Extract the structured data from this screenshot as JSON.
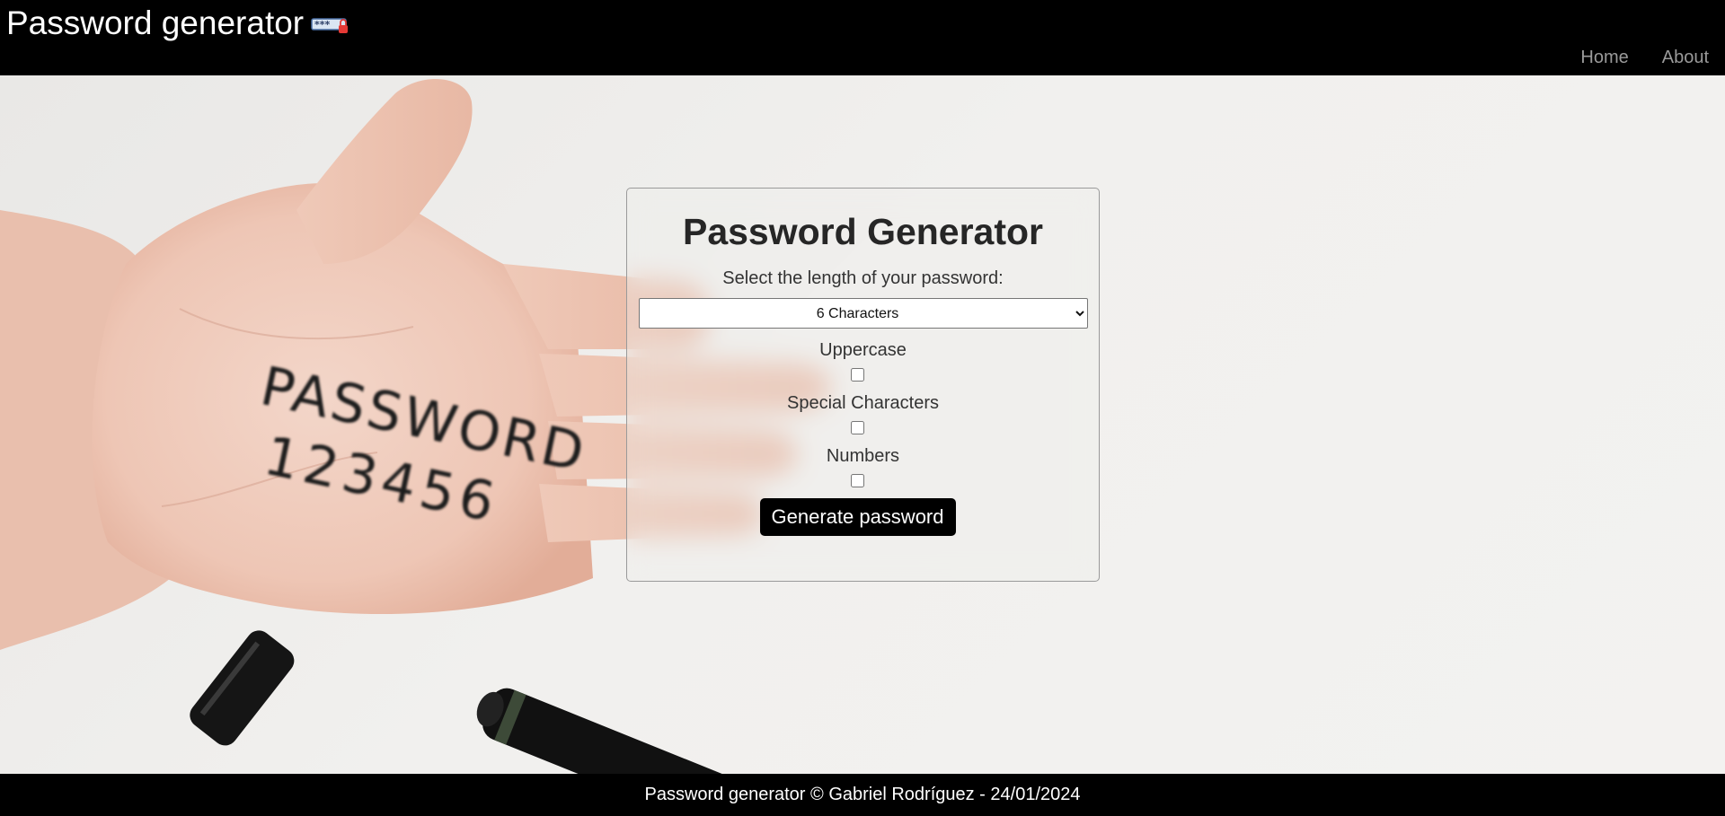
{
  "header": {
    "title": "Password generator",
    "logo_icon": "password-lock-icon",
    "logo_text": "***",
    "nav": [
      {
        "label": "Home"
      },
      {
        "label": "About"
      }
    ]
  },
  "background": {
    "hand_writing_line1": "PASSWORD",
    "hand_writing_line2": "123456"
  },
  "card": {
    "title": "Password Generator",
    "length_label": "Select the length of your password:",
    "length_selected": "6 Characters",
    "options": [
      {
        "label": "Uppercase",
        "checked": false
      },
      {
        "label": "Special Characters",
        "checked": false
      },
      {
        "label": "Numbers",
        "checked": false
      }
    ],
    "generate_label": "Generate password"
  },
  "footer": {
    "text": "Password generator © Gabriel Rodríguez - 24/01/2024"
  },
  "colors": {
    "header_bg": "#000000",
    "nav_link": "#9a9a9a",
    "button_bg": "#000000",
    "page_bg": "#efeeec"
  }
}
